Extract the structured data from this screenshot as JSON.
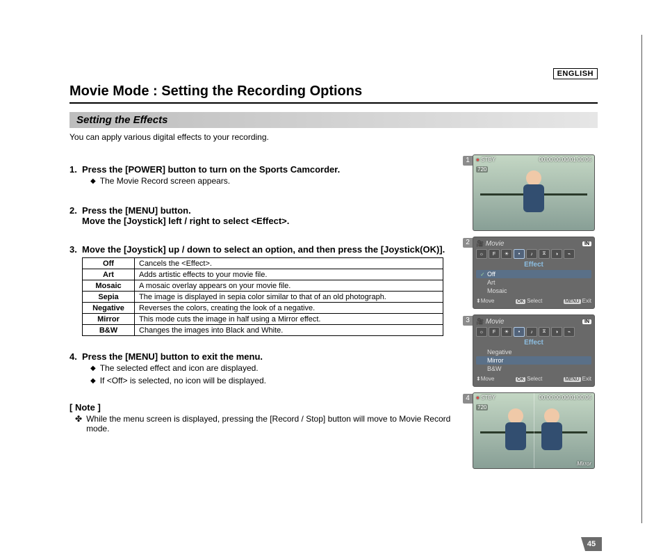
{
  "language_badge": "ENGLISH",
  "page_title": "Movie Mode : Setting the Recording Options",
  "subtitle": "Setting the Effects",
  "intro": "You can apply various digital effects to your recording.",
  "steps": [
    {
      "num": "1.",
      "text": "Press the [POWER] button to turn on the Sports Camcorder.",
      "subs": [
        "The Movie Record screen appears."
      ]
    },
    {
      "num": "2.",
      "text": "Press the [MENU] button.\nMove the [Joystick] left / right to select <Effect>.",
      "subs": []
    },
    {
      "num": "3.",
      "text": "Move the [Joystick] up / down to select an option, and then press the [Joystick(OK)].",
      "subs": []
    },
    {
      "num": "4.",
      "text": "Press the [MENU] button to exit the menu.",
      "subs": [
        "The selected effect and icon are displayed.",
        "If <Off> is selected, no icon will be displayed."
      ]
    }
  ],
  "effects_table": [
    {
      "name": "Off",
      "desc": "Cancels the <Effect>."
    },
    {
      "name": "Art",
      "desc": "Adds artistic effects to your movie file."
    },
    {
      "name": "Mosaic",
      "desc": "A mosaic overlay appears on your movie file."
    },
    {
      "name": "Sepia",
      "desc": "The image is displayed in sepia color similar to that of an old photograph."
    },
    {
      "name": "Negative",
      "desc": "Reverses the colors, creating the look of a negative."
    },
    {
      "name": "Mirror",
      "desc": "This mode cuts the image in half using a Mirror effect."
    },
    {
      "name": "B&W",
      "desc": "Changes the images into Black and White."
    }
  ],
  "note_heading": "[ Note ]",
  "notes": [
    "While the menu screen is displayed, pressing the [Record / Stop] button will move to Movie Record mode."
  ],
  "figures": {
    "f1": {
      "tab": "1",
      "status": "STBY",
      "time": "00:00:00:00/01:00:06",
      "res": "720"
    },
    "f2": {
      "tab": "2",
      "mode": "Movie",
      "badge": "IN",
      "menu_title": "Effect",
      "options": [
        "Off",
        "Art",
        "Mosaic"
      ],
      "selected": "Off",
      "checked": "Off",
      "hints": {
        "move": "Move",
        "select": "Select",
        "exit": "Exit",
        "ok": "OK",
        "menu": "MENU"
      }
    },
    "f3": {
      "tab": "3",
      "mode": "Movie",
      "badge": "IN",
      "menu_title": "Effect",
      "options": [
        "Negative",
        "Mirror",
        "B&W"
      ],
      "selected": "Mirror",
      "checked": "",
      "hints": {
        "move": "Move",
        "select": "Select",
        "exit": "Exit",
        "ok": "OK",
        "menu": "MENU"
      }
    },
    "f4": {
      "tab": "4",
      "status": "STBY",
      "time": "00:00:00:00/01:00:06",
      "res": "720",
      "effect_label": "Mirror"
    }
  },
  "page_number": "45"
}
